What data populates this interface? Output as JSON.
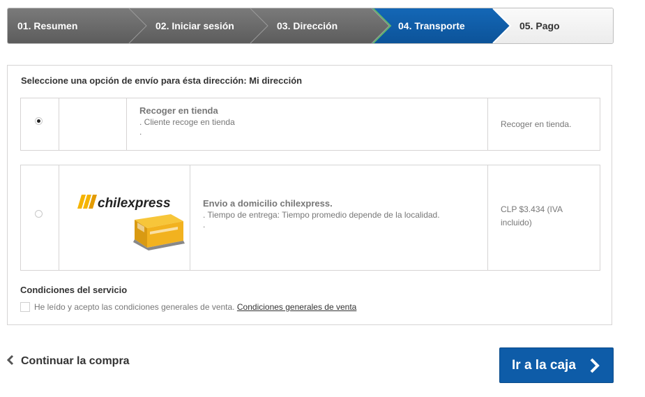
{
  "steps": [
    {
      "label": "01. Resumen",
      "state": "done"
    },
    {
      "label": "02. Iniciar sesión",
      "state": "done"
    },
    {
      "label": "03. Dirección",
      "state": "done"
    },
    {
      "label": "04. Transporte",
      "state": "current"
    },
    {
      "label": "05. Pago",
      "state": "todo"
    }
  ],
  "shipping": {
    "title": "Seleccione una opción de envío para ésta dirección: Mi dirección",
    "options": [
      {
        "selected": true,
        "name": "Recoger en tienda",
        "line1": ". Cliente recoge en tienda",
        "line2": ".",
        "price": "Recoger en tienda."
      },
      {
        "selected": false,
        "logo_text": "chilexpress",
        "name": "Envio a domicilio chilexpress.",
        "line1": ". Tiempo de entrega: Tiempo promedio depende de la localidad.",
        "line2": ".",
        "price": "CLP $3.434 (IVA incluido)"
      }
    ]
  },
  "conditions": {
    "title": "Condiciones del servicio",
    "checked": false,
    "text": "He leído y acepto las condiciones generales de venta.",
    "link": "Condiciones generales de venta"
  },
  "actions": {
    "continue_label": "Continuar la compra",
    "checkout_label": "Ir a la caja"
  },
  "colors": {
    "step_done": "#6f6f6f",
    "step_current": "#0e5ca8",
    "step_todo": "#f3f3f3",
    "accent_border": "#5fb46a",
    "primary_button": "#0e5ca8",
    "logo_yellow": "#f5b400"
  },
  "icons": {
    "continue": "chevron-left-icon",
    "checkout": "chevron-right-icon",
    "radio": "radio-icon"
  }
}
